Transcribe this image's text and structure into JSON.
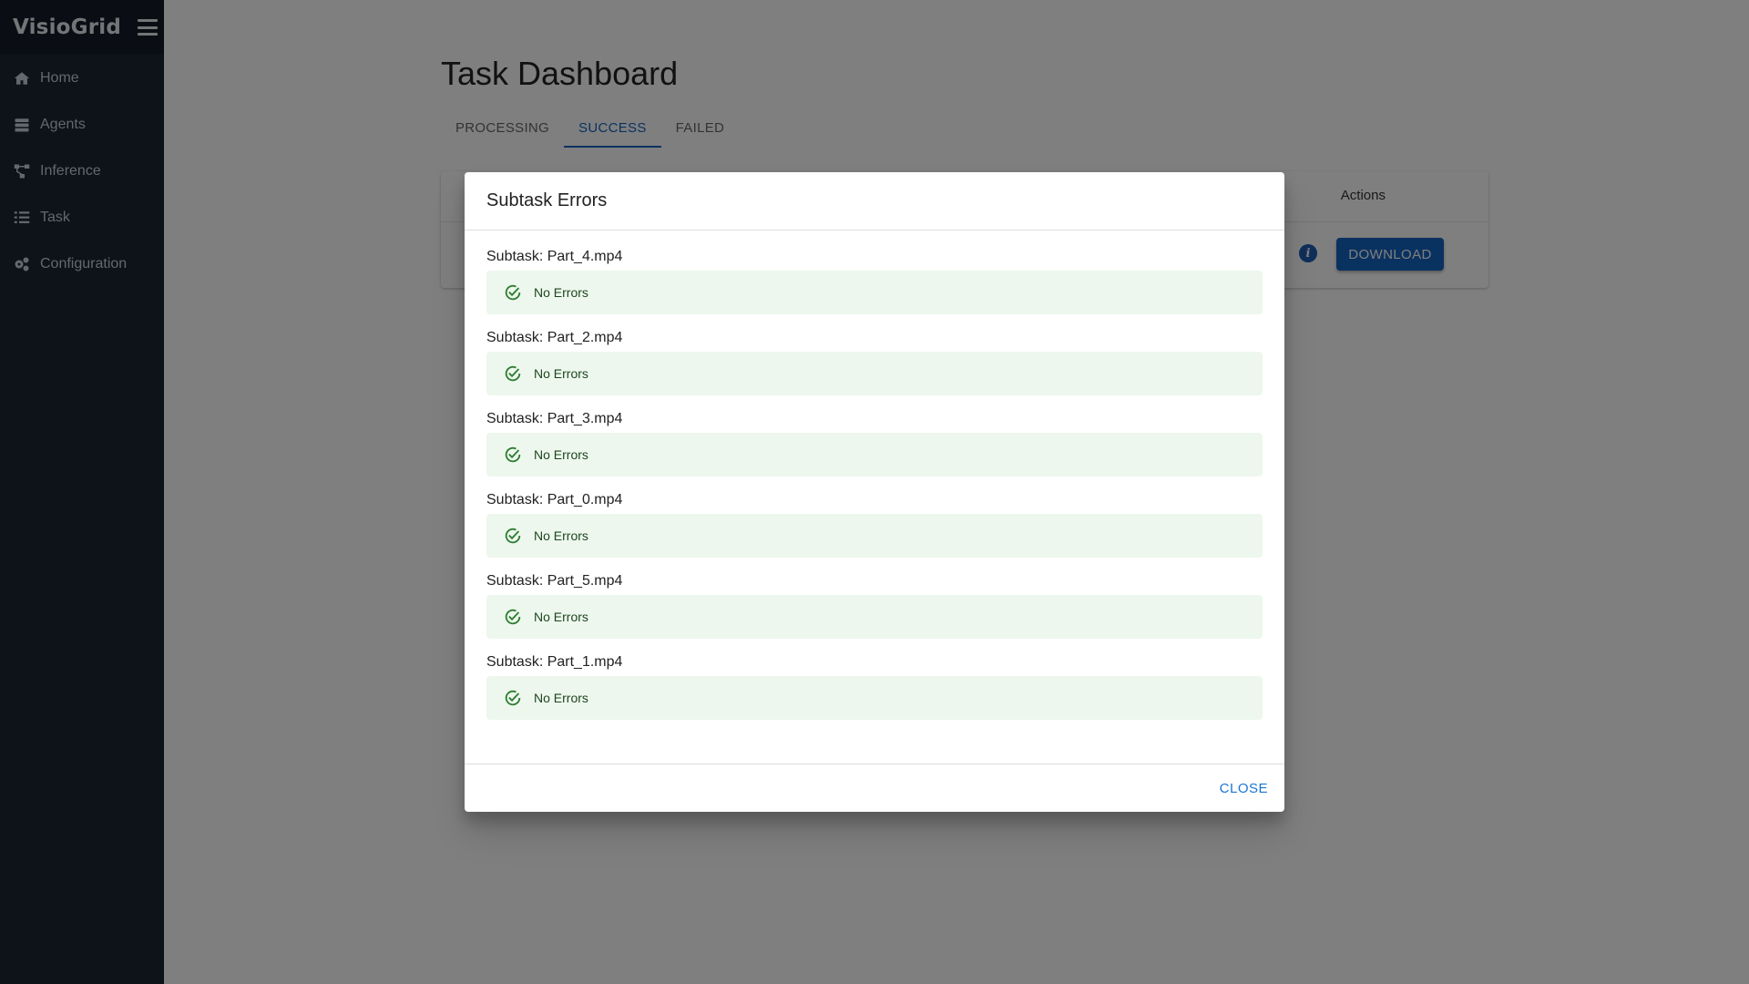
{
  "sidebar": {
    "brand": "VisioGrid",
    "items": [
      {
        "label": "Home",
        "icon": "home-icon"
      },
      {
        "label": "Agents",
        "icon": "server-icon"
      },
      {
        "label": "Inference",
        "icon": "network-icon"
      },
      {
        "label": "Task",
        "icon": "list-icon"
      },
      {
        "label": "Configuration",
        "icon": "gears-icon"
      }
    ]
  },
  "main": {
    "title": "Task Dashboard",
    "tabs": [
      {
        "label": "PROCESSING",
        "active": false
      },
      {
        "label": "SUCCESS",
        "active": true
      },
      {
        "label": "FAILED",
        "active": false
      }
    ],
    "table": {
      "actions_header": "Actions",
      "download_label": "DOWNLOAD",
      "info_icon": "info-icon"
    }
  },
  "dialog": {
    "title": "Subtask Errors",
    "subtasks": [
      {
        "name": "Subtask: Part_4.mp4",
        "status": "No Errors"
      },
      {
        "name": "Subtask: Part_2.mp4",
        "status": "No Errors"
      },
      {
        "name": "Subtask: Part_3.mp4",
        "status": "No Errors"
      },
      {
        "name": "Subtask: Part_0.mp4",
        "status": "No Errors"
      },
      {
        "name": "Subtask: Part_5.mp4",
        "status": "No Errors"
      },
      {
        "name": "Subtask: Part_1.mp4",
        "status": "No Errors"
      }
    ],
    "close_label": "CLOSE"
  },
  "colors": {
    "sidebar_bg": "#1c2532",
    "primary": "#1565c0",
    "success_bg": "#edf7ed",
    "success_icon": "#2e7d32"
  }
}
